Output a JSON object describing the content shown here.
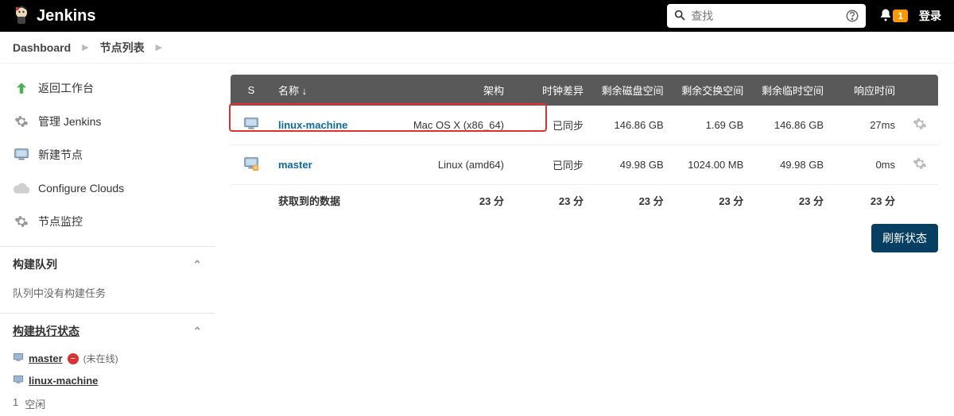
{
  "header": {
    "app_name": "Jenkins",
    "search_placeholder": "查找",
    "notification_count": "1",
    "login_label": "登录"
  },
  "breadcrumbs": {
    "dashboard": "Dashboard",
    "nodes": "节点列表"
  },
  "sidebar": {
    "back": "返回工作台",
    "manage": "管理 Jenkins",
    "new_node": "新建节点",
    "configure_clouds": "Configure Clouds",
    "node_monitor": "节点监控",
    "build_queue_title": "构建队列",
    "build_queue_empty": "队列中没有构建任务",
    "exec_status_title": "构建执行状态",
    "exec_master": "master",
    "exec_master_offline": "未在线",
    "exec_linux": "linux-machine",
    "idle_num": "1",
    "idle_label": "空闲"
  },
  "table": {
    "columns": {
      "s": "S",
      "name": "名称 ↓",
      "arch": "架构",
      "clock": "时钟差异",
      "disk": "剩余磁盘空间",
      "swap": "剩余交换空间",
      "temp": "剩余临时空间",
      "response": "响应时间"
    },
    "rows": [
      {
        "name": "linux-machine",
        "arch": "Mac OS X (x86_64)",
        "clock": "已同步",
        "disk": "146.86 GB",
        "swap": "1.69 GB",
        "temp": "146.86 GB",
        "response": "27ms"
      },
      {
        "name": "master",
        "arch": "Linux (amd64)",
        "clock": "已同步",
        "disk": "49.98 GB",
        "swap": "1024.00 MB",
        "temp": "49.98 GB",
        "response": "0ms"
      }
    ],
    "footer": {
      "label": "获取到的数据",
      "arch": "23 分",
      "clock": "23 分",
      "disk": "23 分",
      "swap": "23 分",
      "temp": "23 分",
      "response": "23 分"
    },
    "refresh_button": "刷新状态"
  }
}
